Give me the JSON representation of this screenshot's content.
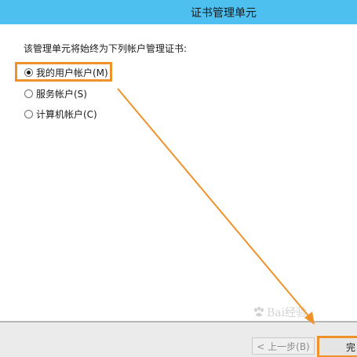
{
  "window": {
    "title": "证书管理单元"
  },
  "dialog": {
    "instruction": "该管理单元将始终为下列帐户管理证书:",
    "options": [
      {
        "label": "我的用户帐户(M)",
        "checked": true
      },
      {
        "label": "服务帐户(S)",
        "checked": false
      },
      {
        "label": "计算机帐户(C)",
        "checked": false
      }
    ]
  },
  "footer": {
    "back_label": "< 上一步(B)",
    "finish_label": "完"
  },
  "annotation": {
    "highlight_color": "#f0922a"
  },
  "watermark": {
    "text": "Bai经验",
    "icon": "baidu-paw-icon"
  },
  "colors": {
    "titlebar": "#4ec0f0",
    "footer": "#ebebeb"
  }
}
